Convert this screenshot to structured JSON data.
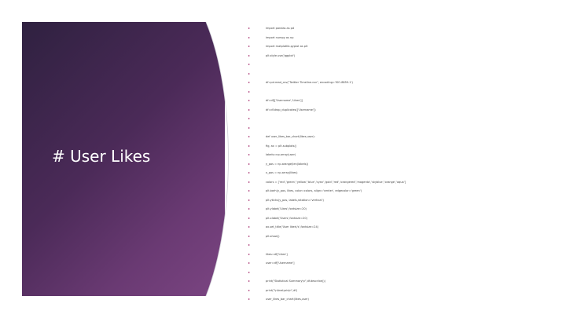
{
  "slide": {
    "title": "# User Likes",
    "bullet_color": "#a4276a",
    "panel_color": "#4b2a58",
    "code_lines": [
      "import pandas as pd",
      "import numpy as np",
      "import matplotlib.pyplot as plt",
      "plt.style.use('ggplot')",
      "",
      "",
      "df=pd.read_csv(\"Twitter Timeline.csv\", encoding='ISO-8859-1')",
      "",
      "df=df[['Username','Likes']]",
      "df=df.drop_duplicates(['Username'])",
      "",
      "",
      "def user_likes_bar_chart(likes,user):",
      "    fig, ax = plt.subplots()",
      "    labels=np.array(user)",
      "    y_pos = np.arange(len(labels))",
      "    x_pos = np.array(likes)",
      "    colors = ['red','green','yellow','blue','cyan','gold','red','orangered','magenta','skyblue','orange','aqua']",
      "    plt.barh(y_pos, likes, color=colors, align='center', edgecolor='green')",
      "    plt.yticks(y_pos, labels,rotation='vertical')",
      "    plt.ylabel('Likes',fontsize=20)",
      "    plt.xlabel('Users',fontsize=20)",
      "    ax.set_title('User likes\\'s',fontsize=24)",
      "    plt.show()",
      "",
      "likes=df['Likes']",
      "user=df['Username']",
      "",
      "print(\"Statistical Summary\\n\",df.describe())",
      "print(\"\\nAnalysis\\n\",df)",
      "user_likes_bar_chart(likes,user)"
    ]
  }
}
